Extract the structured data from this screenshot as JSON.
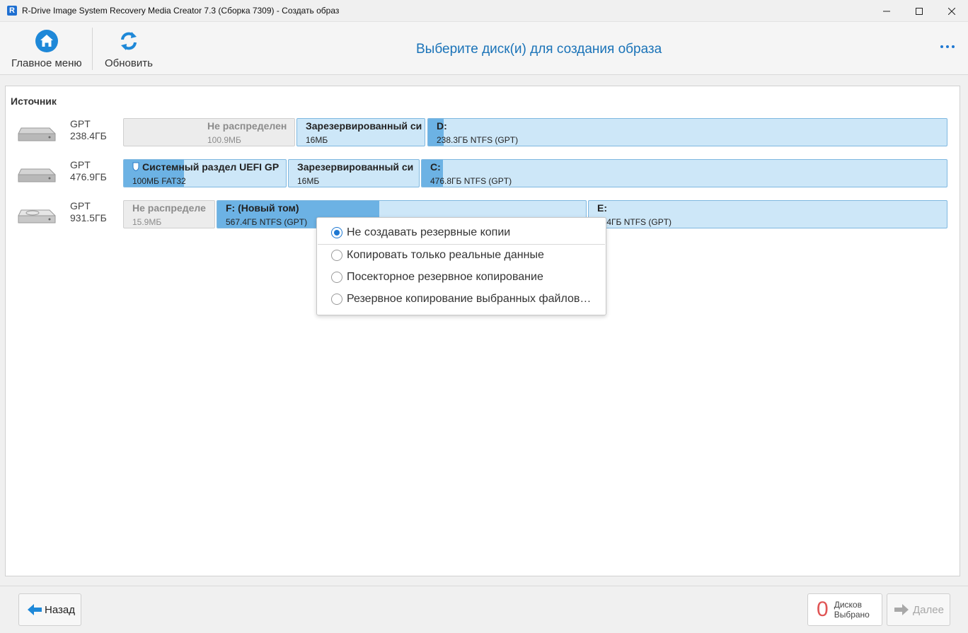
{
  "window": {
    "app_icon_letter": "R",
    "title": "R-Drive Image System Recovery Media Creator 7.3 (Сборка 7309) - Создать образ"
  },
  "toolbar": {
    "main_menu_label": "Главное меню",
    "refresh_label": "Обновить",
    "page_title": "Выберите диск(и) для создания образа"
  },
  "panel": {
    "source_label": "Источник"
  },
  "disks": [
    {
      "type": "GPT",
      "size": "238.4ГБ",
      "partitions": [
        {
          "name": "Не распределен",
          "info": "100.9МБ",
          "unallocated": true,
          "used_fraction": 0
        },
        {
          "name": "Зарезервированный си",
          "info": "16МБ",
          "unallocated": false,
          "used_fraction": 0
        },
        {
          "name": "D:",
          "info": "238.3ГБ NTFS (GPT)",
          "unallocated": false,
          "used_fraction": 0.03
        }
      ]
    },
    {
      "type": "GPT",
      "size": "476.9ГБ",
      "partitions": [
        {
          "name": "Системный раздел UEFI GP",
          "info": "100МБ FAT32",
          "unallocated": false,
          "used_fraction": 0.37,
          "shield_icon": true
        },
        {
          "name": "Зарезервированный си",
          "info": "16МБ",
          "unallocated": false,
          "used_fraction": 0
        },
        {
          "name": "C:",
          "info": "476.8ГБ NTFS (GPT)",
          "unallocated": false,
          "used_fraction": 0.04
        }
      ]
    },
    {
      "type": "GPT",
      "size": "931.5ГБ",
      "partitions": [
        {
          "name": "Не распределе",
          "info": "15.9МБ",
          "unallocated": true,
          "used_fraction": 0
        },
        {
          "name": "F: (Новый том)",
          "info": "567.4ГБ NTFS (GPT)",
          "unallocated": false,
          "used_fraction": 0.44
        },
        {
          "name": "E:",
          "info": "364ГБ NTFS (GPT)",
          "unallocated": false,
          "used_fraction": 0
        }
      ]
    }
  ],
  "backup_menu": {
    "options": [
      {
        "label": "Не создавать резервные копии",
        "selected": true
      },
      {
        "label": "Копировать только реальные данные",
        "selected": false
      },
      {
        "label": "Посекторное резервное копирование",
        "selected": false
      },
      {
        "label": "Резервное копирование выбранных файлов…",
        "selected": false
      }
    ]
  },
  "footer": {
    "back_label": "Назад",
    "count": "0",
    "count_label_line1": "Дисков",
    "count_label_line2": "Выбрано",
    "next_label": "Далее"
  },
  "colors": {
    "accent": "#1a73b8",
    "partition_bg": "#cde7f8",
    "partition_used": "#6cb2e4",
    "unallocated_bg": "#ececec",
    "count_color": "#e05555"
  }
}
